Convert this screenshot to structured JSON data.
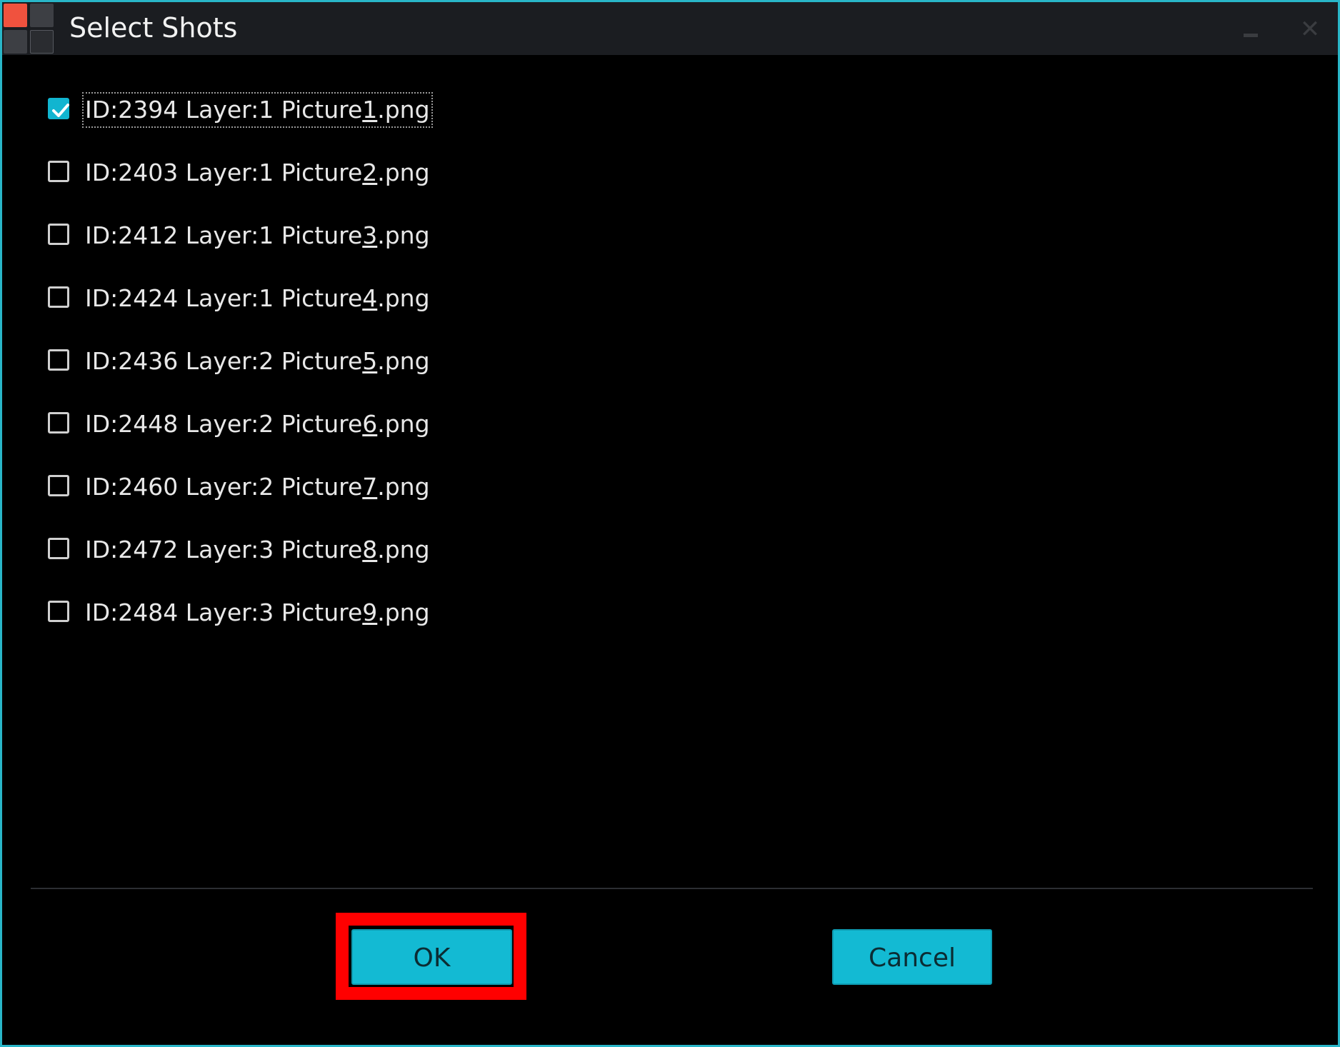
{
  "window": {
    "title": "Select Shots"
  },
  "items": [
    {
      "prefix": "ID:2394 Layer:1 Picture",
      "mnemonic": "1",
      "suffix": ".png",
      "checked": true,
      "focused": true
    },
    {
      "prefix": "ID:2403 Layer:1 Picture",
      "mnemonic": "2",
      "suffix": ".png",
      "checked": false,
      "focused": false
    },
    {
      "prefix": "ID:2412 Layer:1 Picture",
      "mnemonic": "3",
      "suffix": ".png",
      "checked": false,
      "focused": false
    },
    {
      "prefix": "ID:2424 Layer:1 Picture",
      "mnemonic": "4",
      "suffix": ".png",
      "checked": false,
      "focused": false
    },
    {
      "prefix": "ID:2436 Layer:2 Picture",
      "mnemonic": "5",
      "suffix": ".png",
      "checked": false,
      "focused": false
    },
    {
      "prefix": "ID:2448 Layer:2 Picture",
      "mnemonic": "6",
      "suffix": ".png",
      "checked": false,
      "focused": false
    },
    {
      "prefix": "ID:2460 Layer:2 Picture",
      "mnemonic": "7",
      "suffix": ".png",
      "checked": false,
      "focused": false
    },
    {
      "prefix": "ID:2472 Layer:3 Picture",
      "mnemonic": "8",
      "suffix": ".png",
      "checked": false,
      "focused": false
    },
    {
      "prefix": "ID:2484 Layer:3 Picture",
      "mnemonic": "9",
      "suffix": ".png",
      "checked": false,
      "focused": false
    }
  ],
  "buttons": {
    "ok_label": "OK",
    "cancel_label": "Cancel"
  },
  "colors": {
    "accent": "#13bad3",
    "highlight": "#ff0000",
    "background": "#000000",
    "titlebar": "#1b1d21"
  },
  "icons": {
    "app": "app-logo-icon",
    "minimize": "minimize-icon",
    "close": "close-icon",
    "check": "checkmark-icon"
  }
}
